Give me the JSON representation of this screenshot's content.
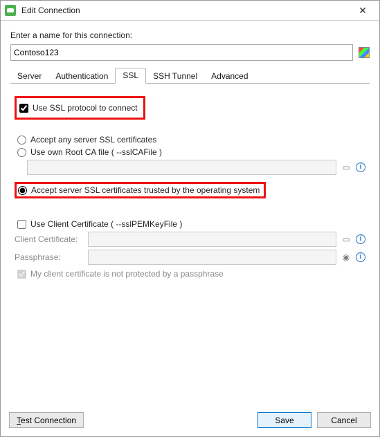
{
  "window": {
    "title": "Edit Connection"
  },
  "prompt": "Enter a name for this connection:",
  "connection": {
    "name": "Contoso123"
  },
  "tabs": {
    "server": "Server",
    "authentication": "Authentication",
    "ssl": "SSL",
    "ssh": "SSH Tunnel",
    "advanced": "Advanced",
    "active": "ssl"
  },
  "ssl": {
    "use_ssl_label": "Use SSL protocol to connect",
    "use_ssl_checked": true,
    "mode": "os_trusted",
    "accept_any_label": "Accept any server SSL certificates",
    "use_own_ca_label": "Use own Root CA file ( --sslCAFile )",
    "own_ca_path": "",
    "os_trusted_label": "Accept server SSL certificates trusted by the operating system",
    "use_client_cert_label": "Use Client Certificate ( --sslPEMKeyFile )",
    "use_client_cert_checked": false,
    "client_cert_label": "Client Certificate:",
    "client_cert_path": "",
    "passphrase_label": "Passphrase:",
    "passphrase_value": "",
    "not_protected_label": "My client certificate is not protected by a passphrase",
    "not_protected_checked": true
  },
  "buttons": {
    "test": "Test Connection",
    "save": "Save",
    "cancel": "Cancel"
  }
}
